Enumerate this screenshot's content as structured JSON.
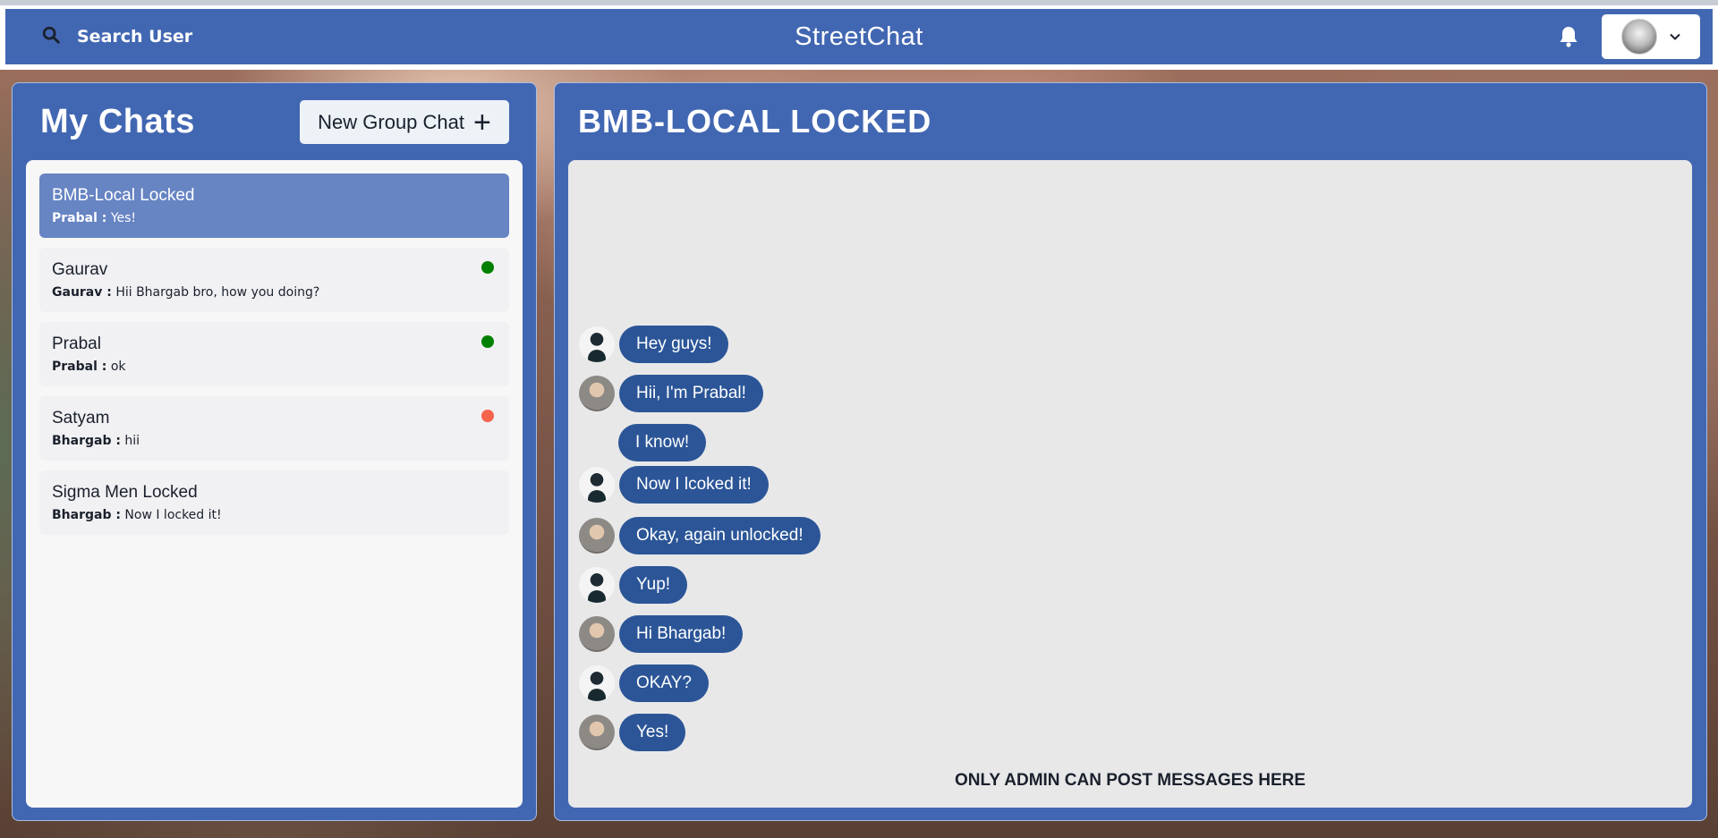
{
  "header": {
    "search_label": "Search User",
    "app_title": "StreetChat"
  },
  "sidebar": {
    "title": "My Chats",
    "new_group_label": "New Group Chat",
    "chats": [
      {
        "name": "BMB-Local Locked",
        "sender": "Prabal :",
        "preview": "Yes!",
        "active": true,
        "status": null
      },
      {
        "name": "Gaurav",
        "sender": "Gaurav :",
        "preview": "Hii Bhargab bro, how you doing?",
        "active": false,
        "status": "#008000"
      },
      {
        "name": "Prabal",
        "sender": "Prabal :",
        "preview": "ok",
        "active": false,
        "status": "#008000"
      },
      {
        "name": "Satyam",
        "sender": "Bhargab :",
        "preview": "hii",
        "active": false,
        "status": "#f5634a"
      },
      {
        "name": "Sigma Men Locked",
        "sender": "Bhargab :",
        "preview": "Now I locked it!",
        "active": false,
        "status": null
      }
    ]
  },
  "conversation": {
    "title": "BMB-LOCAL LOCKED",
    "messages": [
      {
        "text": "Hey guys!",
        "avatar": "bhargab-avatar"
      },
      {
        "text": "Hii, I'm Prabal!",
        "avatar": "prabal-avatar"
      },
      {
        "text": "I know!",
        "avatar": null
      },
      {
        "text": "Now I lcoked it!",
        "avatar": "bhargab-avatar"
      },
      {
        "text": "Okay, again unlocked!",
        "avatar": "prabal-avatar"
      },
      {
        "text": "Yup!",
        "avatar": "bhargab-avatar"
      },
      {
        "text": "Hi Bhargab!",
        "avatar": "prabal-avatar"
      },
      {
        "text": "OKAY?",
        "avatar": "bhargab-avatar"
      },
      {
        "text": "Yes!",
        "avatar": "prabal-avatar"
      }
    ],
    "admin_notice": "ONLY ADMIN CAN POST MESSAGES HERE"
  },
  "colors": {
    "header_bg": "#4267b2",
    "bubble_bg": "#2b5597",
    "active_chat_bg": "#6784c3",
    "online": "#008000",
    "offline": "#f5634a"
  },
  "icons": [
    "search-icon",
    "bell-icon",
    "chevron-down-icon",
    "plus-icon"
  ]
}
